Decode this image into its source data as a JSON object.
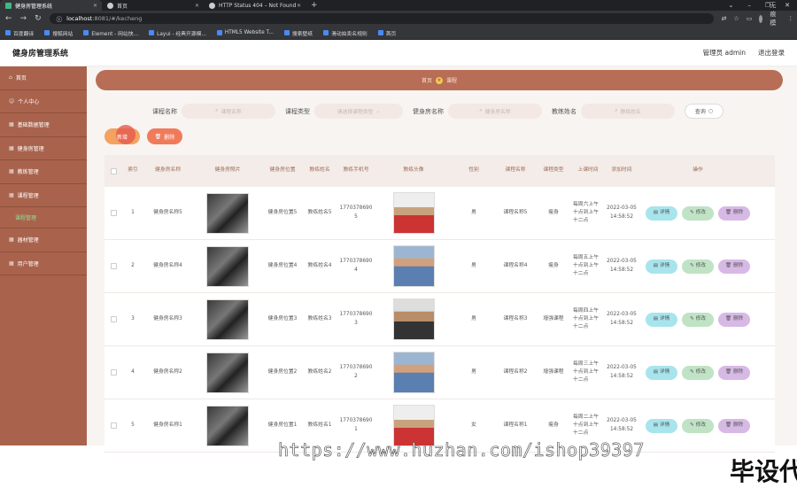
{
  "browser": {
    "tabs": [
      {
        "label": "健身房管理系统",
        "active": true
      },
      {
        "label": "首页",
        "active": false
      },
      {
        "label": "HTTP Status 404 – Not Found",
        "active": false
      }
    ],
    "url_host": "localhost",
    "url_rest": ":8081/#/kecheng",
    "profile_label": "无痕模式",
    "bookmarks": [
      "百度翻译",
      "搜狐网站",
      "Element - 网站快...",
      "Layui - 经典开源模...",
      "HTML5 Website T...",
      "搜索壁纸",
      "滑动拍卖名规则",
      "首页"
    ]
  },
  "header": {
    "title": "健身房管理系统",
    "user": "管理员 admin",
    "logout": "退出登录"
  },
  "sidebar": {
    "items": [
      {
        "label": "首页",
        "icon": "home-icon"
      },
      {
        "label": "个人中心",
        "icon": "user-icon"
      },
      {
        "label": "基础数据管理",
        "icon": "data-icon"
      },
      {
        "label": "健身房管理",
        "icon": "gym-icon"
      },
      {
        "label": "教练管理",
        "icon": "coach-icon"
      },
      {
        "label": "课程管理",
        "icon": "course-icon"
      },
      {
        "label": "器材管理",
        "icon": "equipment-icon"
      },
      {
        "label": "用户管理",
        "icon": "users-icon"
      }
    ],
    "sub_item": "课程管理"
  },
  "breadcrumb": {
    "home": "首页",
    "current": "课程"
  },
  "search": {
    "fields": [
      {
        "label": "课程名称",
        "placeholder": "课程名称"
      },
      {
        "label": "课程类型",
        "placeholder": "请选择课程类型"
      },
      {
        "label": "健身房名称",
        "placeholder": "健身房名称"
      },
      {
        "label": "教练姓名",
        "placeholder": "教练姓名"
      }
    ],
    "query_label": "查询"
  },
  "actions": {
    "add_label": "新增",
    "delete_label": "删除"
  },
  "table": {
    "headers": [
      "索引",
      "健身房名称",
      "健身房照片",
      "健身房位置",
      "教练姓名",
      "教练手机号",
      "教练头像",
      "性别",
      "课程名称",
      "课程类型",
      "上课时间",
      "添加时间",
      "操作"
    ],
    "rows": [
      {
        "idx": "1",
        "gym_name": "健身房名称5",
        "gym_loc": "健身房位置5",
        "coach": "教练姓名5",
        "phone": "17703786905",
        "gender": "男",
        "course": "课程名称5",
        "type": "瘦身",
        "time": "每周六上午十点到上午十二点",
        "added": "2022-03-05 14:58:52"
      },
      {
        "idx": "2",
        "gym_name": "健身房名称4",
        "gym_loc": "健身房位置4",
        "coach": "教练姓名4",
        "phone": "17703786904",
        "gender": "男",
        "course": "课程名称4",
        "type": "瘦身",
        "time": "每周五上午十点到上午十二点",
        "added": "2022-03-05 14:58:52"
      },
      {
        "idx": "3",
        "gym_name": "健身房名称3",
        "gym_loc": "健身房位置3",
        "coach": "教练姓名3",
        "phone": "17703786903",
        "gender": "男",
        "course": "课程名称3",
        "type": "增强课程",
        "time": "每周四上午十点到上午十二点",
        "added": "2022-03-05 14:58:52"
      },
      {
        "idx": "4",
        "gym_name": "健身房名称2",
        "gym_loc": "健身房位置2",
        "coach": "教练姓名2",
        "phone": "17703786902",
        "gender": "男",
        "course": "课程名称2",
        "type": "增强课程",
        "time": "每周三上午十点到上午十二点",
        "added": "2022-03-05 14:58:52"
      },
      {
        "idx": "5",
        "gym_name": "健身房名称1",
        "gym_loc": "健身房位置1",
        "coach": "教练姓名1",
        "phone": "17703786901",
        "gender": "女",
        "course": "课程名称1",
        "type": "瘦身",
        "time": "每周二上午十点到上午十二点",
        "added": "2022-03-05 14:58:52"
      }
    ],
    "op_labels": {
      "detail": "详情",
      "edit": "修改",
      "delete": "删除"
    }
  },
  "watermarks": {
    "url": "https://www.huzhan.com/ishop39397",
    "slogan": "毕设代做"
  }
}
